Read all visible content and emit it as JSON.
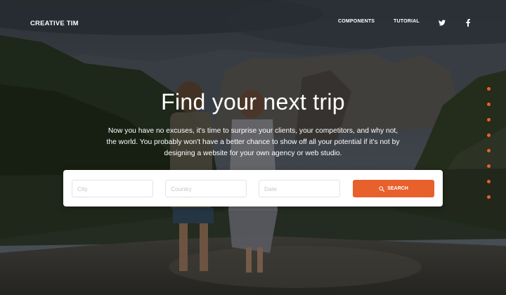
{
  "navbar": {
    "brand": "CREATIVE TIM",
    "links": [
      "COMPONENTS",
      "TUTORIAL"
    ],
    "social_icons": [
      "twitter-icon",
      "facebook-icon"
    ]
  },
  "hero": {
    "title": "Find your next trip",
    "subtitle": "Now you have no excuses, it's time to surprise your clients, your competitors, and why not, the world. You probably won't have a better chance to show off all your potential if it's not by designing a website for your own agency or web studio."
  },
  "search": {
    "city_placeholder": "City",
    "country_placeholder": "Country",
    "date_placeholder": "Date",
    "button_label": "SEARCH",
    "button_icon": "search-icon"
  },
  "pagination": {
    "dot_count": 8
  },
  "colors": {
    "accent": "#e8602c",
    "card": "#ffffff",
    "text": "#ffffff"
  }
}
